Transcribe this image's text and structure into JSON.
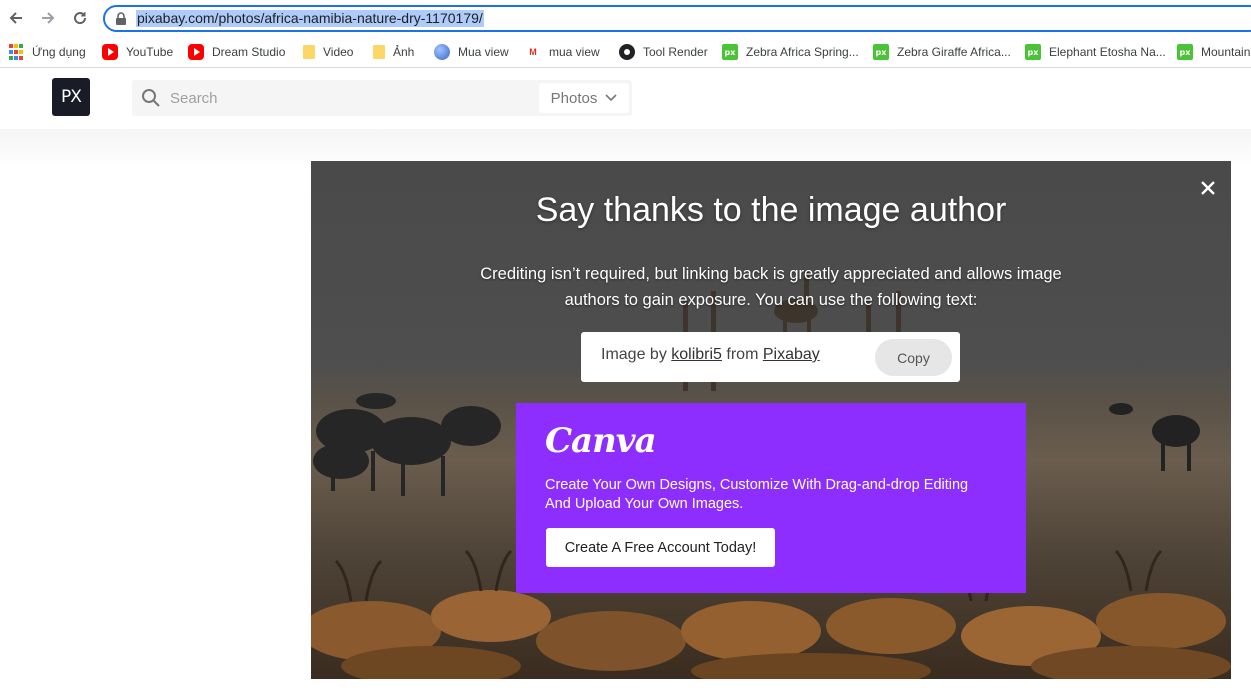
{
  "browser": {
    "url": "pixabay.com/photos/africa-namibia-nature-dry-1170179/",
    "bookmarks": [
      {
        "label": "Ứng dụng",
        "icon": "apps-grid-icon"
      },
      {
        "label": "YouTube",
        "icon": "youtube-icon"
      },
      {
        "label": "Dream Studio",
        "icon": "youtube-icon"
      },
      {
        "label": "Video",
        "icon": "folder-icon"
      },
      {
        "label": "Ảnh",
        "icon": "folder-icon"
      },
      {
        "label": "Mua view",
        "icon": "globe-icon"
      },
      {
        "label": "mua view",
        "icon": "site-icon"
      },
      {
        "label": "Tool Render",
        "icon": "tool-icon"
      },
      {
        "label": "Zebra Africa Spring...",
        "icon": "pixabay-icon"
      },
      {
        "label": "Zebra Giraffe Africa...",
        "icon": "pixabay-icon"
      },
      {
        "label": "Elephant Etosha Na...",
        "icon": "pixabay-icon"
      },
      {
        "label": "Mountain",
        "icon": "pixabay-icon"
      }
    ]
  },
  "header": {
    "logo_text": "PX",
    "search_placeholder": "Search",
    "search_type": "Photos"
  },
  "modal": {
    "title": "Say thanks to the image author",
    "description": "Crediting isn’t required, but linking back is greatly appreciated and allows image authors to gain exposure. You can use the following text:",
    "credit": {
      "prefix": "Image by ",
      "author": "kolibri5",
      "middle": " from ",
      "site": "Pixabay",
      "copy_label": "Copy"
    },
    "canva": {
      "logo": "Canva",
      "description": "Create Your Own Designs, Customize With Drag-and-drop Editing And Upload Your Own Images.",
      "cta": "Create A Free Account Today!",
      "bg_color": "#8d2eff"
    }
  },
  "colors": {
    "omnibox_border": "#1a73e8",
    "url_highlight": "#aecbfa",
    "logo_bg": "#191b26"
  }
}
